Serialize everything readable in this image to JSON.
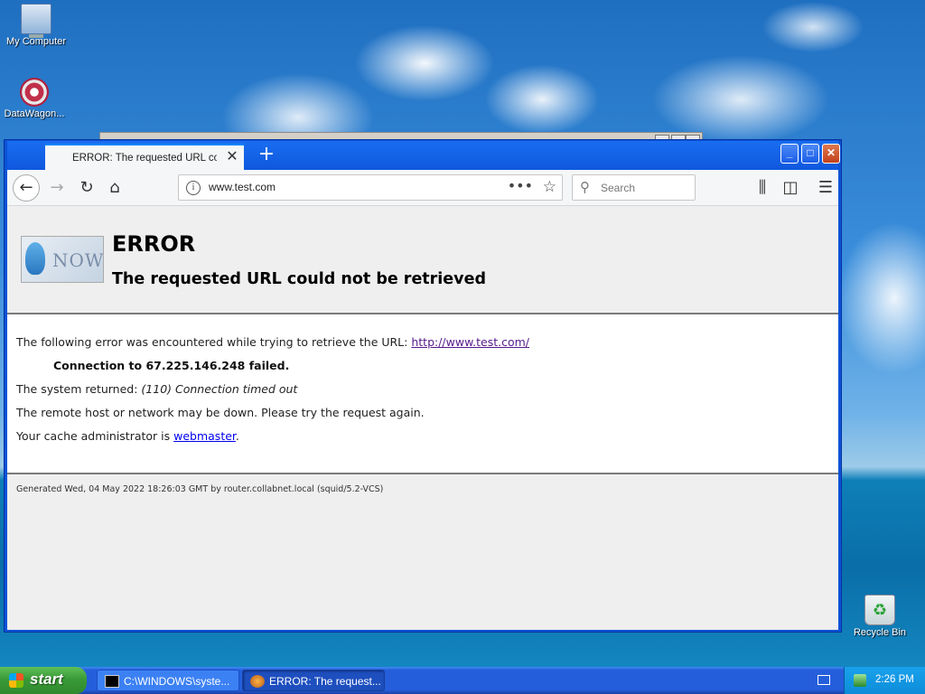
{
  "desktop": {
    "icons": [
      {
        "label": "My Computer"
      },
      {
        "label": "DataWagon..."
      },
      {
        "label": "Recycle Bin"
      }
    ]
  },
  "browser": {
    "tab_title": "ERROR: The requested URL could",
    "tab_close": "✕",
    "new_tab": "+",
    "window_buttons": {
      "minimize": "_",
      "maximize": "□",
      "close": "✕"
    },
    "url": "www.test.com",
    "url_actions": "•••",
    "search_placeholder": "Search"
  },
  "page": {
    "logo_text": "NOW",
    "heading": "ERROR",
    "subheading": "The requested URL could not be retrieved",
    "line1_prefix": "The following error was encountered while trying to retrieve the URL: ",
    "line1_link": "http://www.test.com/",
    "line2": "Connection to 67.225.146.248 failed.",
    "line3_prefix": "The system returned: ",
    "line3_italic": "(110) Connection timed out",
    "line4": "The remote host or network may be down. Please try the request again.",
    "line5_prefix": "Your cache administrator is ",
    "line5_link": "webmaster",
    "line5_suffix": ".",
    "footer": "Generated Wed, 04 May 2022 18:26:03 GMT by router.collabnet.local (squid/5.2-VCS)"
  },
  "taskbar": {
    "start_label": "start",
    "tasks": [
      {
        "label": "C:\\WINDOWS\\syste..."
      },
      {
        "label": "ERROR: The request..."
      }
    ],
    "clock": "2:26 PM"
  }
}
